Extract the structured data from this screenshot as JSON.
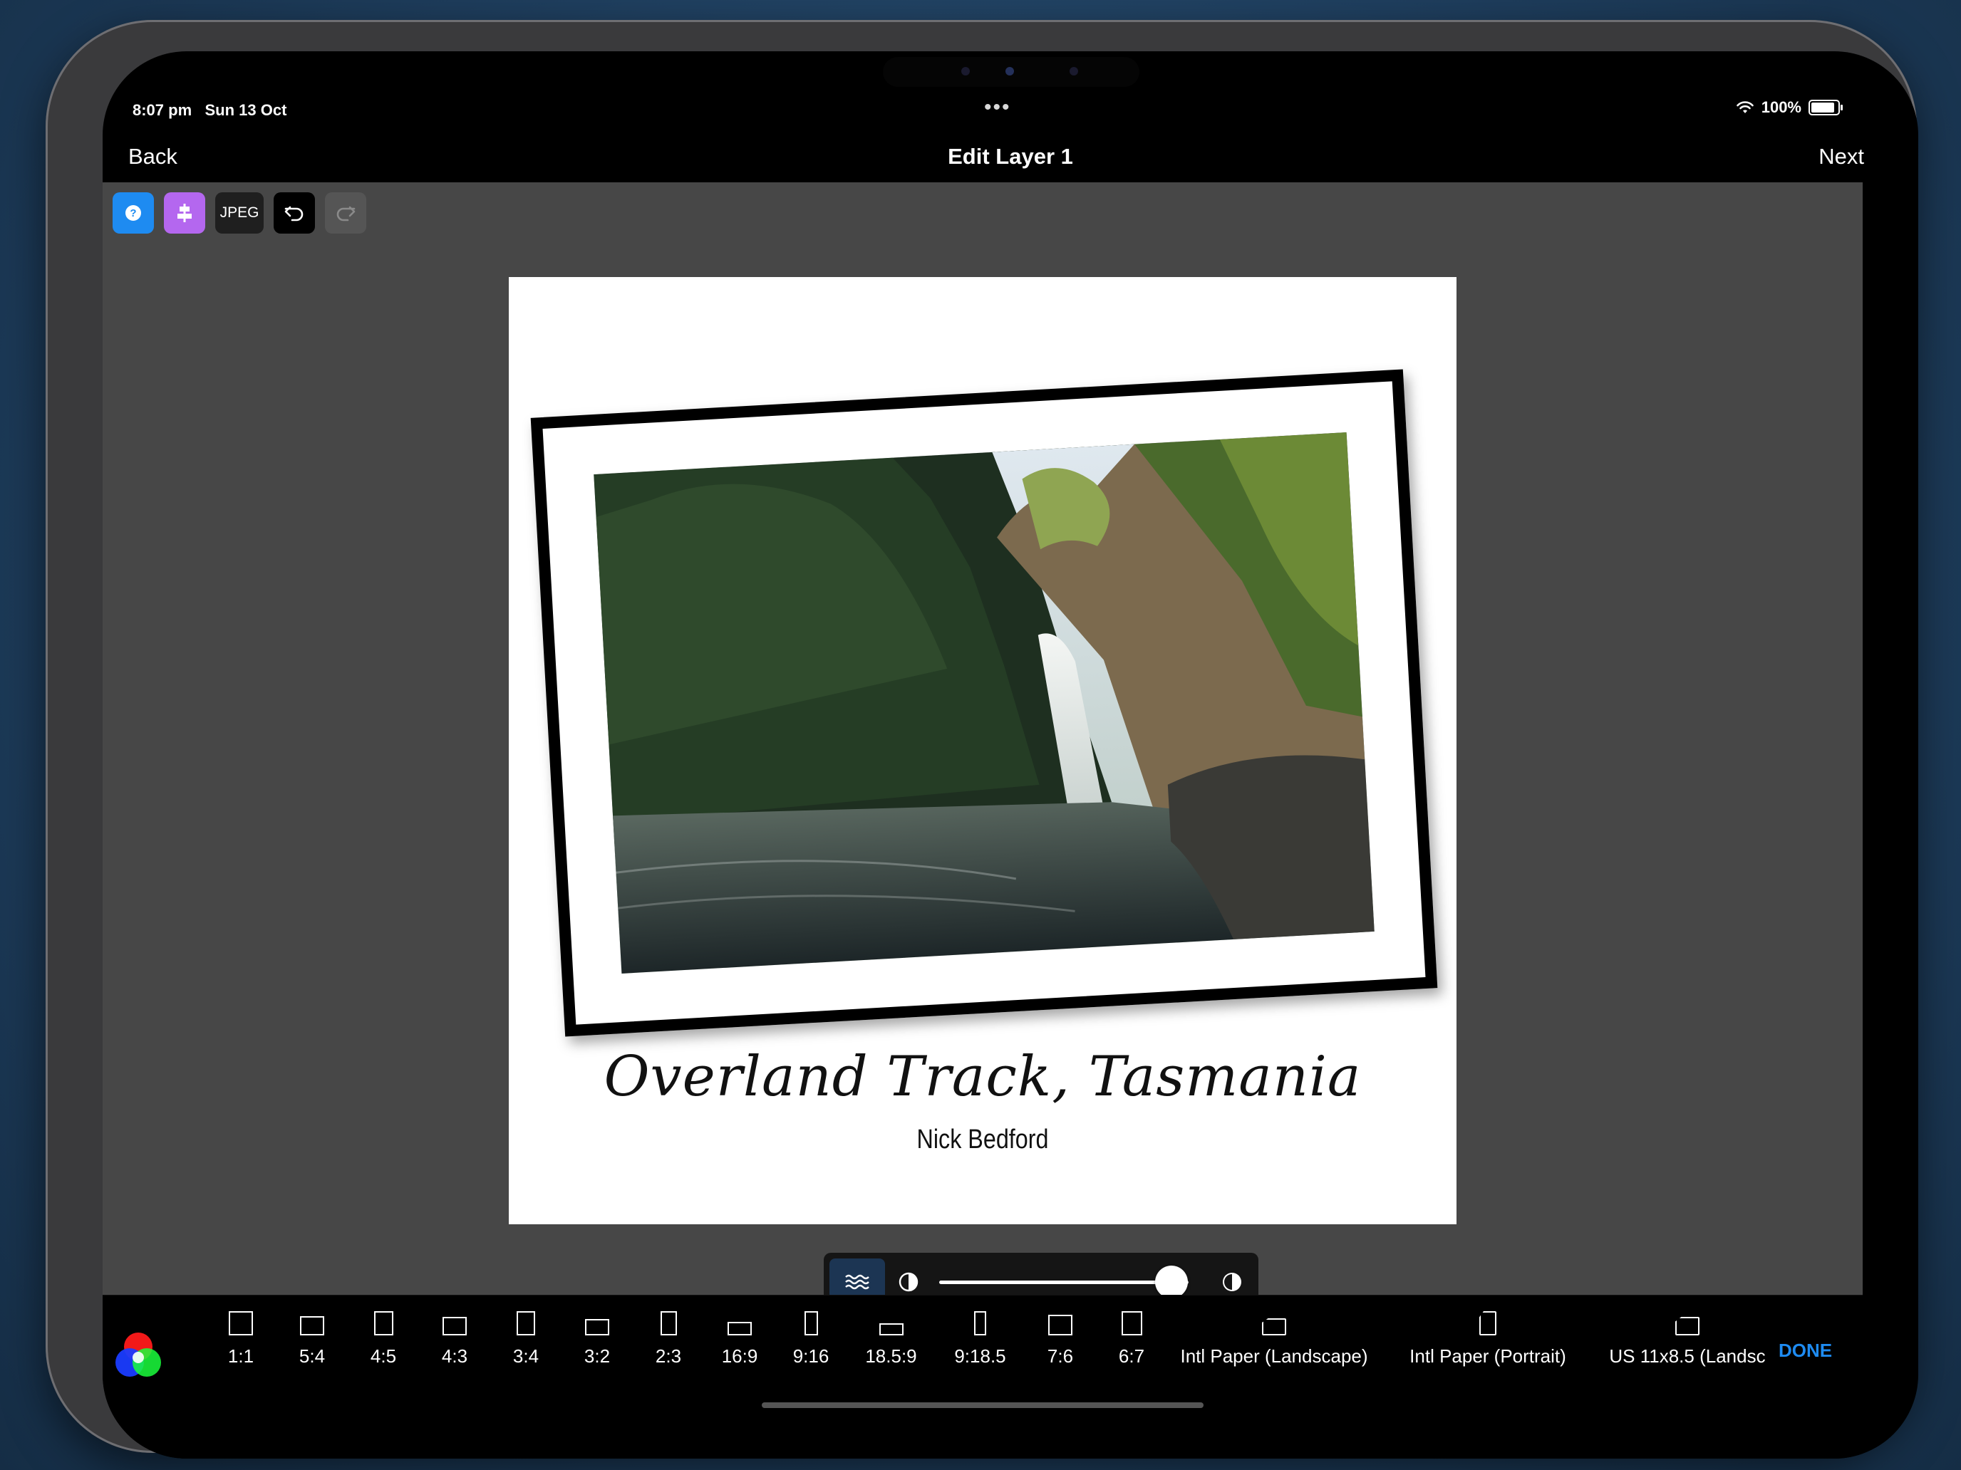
{
  "status_bar": {
    "time": "8:07 pm",
    "date": "Sun 13 Oct",
    "battery": "100%",
    "battery_level": 1.0
  },
  "navbar": {
    "back": "Back",
    "title": "Edit Layer 1",
    "next": "Next"
  },
  "toolbar": {
    "help_icon": "question-icon",
    "align_icon": "align-center-icon",
    "jpeg_label": "JPEG",
    "undo_icon": "undo-icon",
    "redo_icon": "redo-icon"
  },
  "canvas": {
    "caption": "Overland Track, Tasmania",
    "byline": "Nick Bedford"
  },
  "slider": {
    "mode_icon": "waves-icon",
    "left_icon": "contrast-icon",
    "right_icon": "contrast-icon",
    "value": 0.93
  },
  "aspect_ratios": [
    {
      "label": "1:1",
      "w": 1,
      "h": 1
    },
    {
      "label": "5:4",
      "w": 5,
      "h": 4
    },
    {
      "label": "4:5",
      "w": 4,
      "h": 5
    },
    {
      "label": "4:3",
      "w": 4,
      "h": 3
    },
    {
      "label": "3:4",
      "w": 3,
      "h": 4
    },
    {
      "label": "3:2",
      "w": 3,
      "h": 2
    },
    {
      "label": "2:3",
      "w": 2,
      "h": 3
    },
    {
      "label": "16:9",
      "w": 16,
      "h": 9
    },
    {
      "label": "9:16",
      "w": 9,
      "h": 16
    },
    {
      "label": "18.5:9",
      "w": 18.5,
      "h": 9
    },
    {
      "label": "9:18.5",
      "w": 9,
      "h": 18.5
    },
    {
      "label": "7:6",
      "w": 7,
      "h": 6
    },
    {
      "label": "6:7",
      "w": 6,
      "h": 7
    },
    {
      "label": "Intl Paper (Landscape)",
      "w": 1.414,
      "h": 1,
      "paper": true
    },
    {
      "label": "Intl Paper (Portrait)",
      "w": 1,
      "h": 1.414,
      "paper": true
    },
    {
      "label": "US 11x8.5 (Landsc",
      "w": 1.294,
      "h": 1,
      "paper": true
    }
  ],
  "done_label": "DONE",
  "colors": {
    "accent": "#1e8bf1",
    "align_button": "#b467ef",
    "workspace": "#474747"
  }
}
